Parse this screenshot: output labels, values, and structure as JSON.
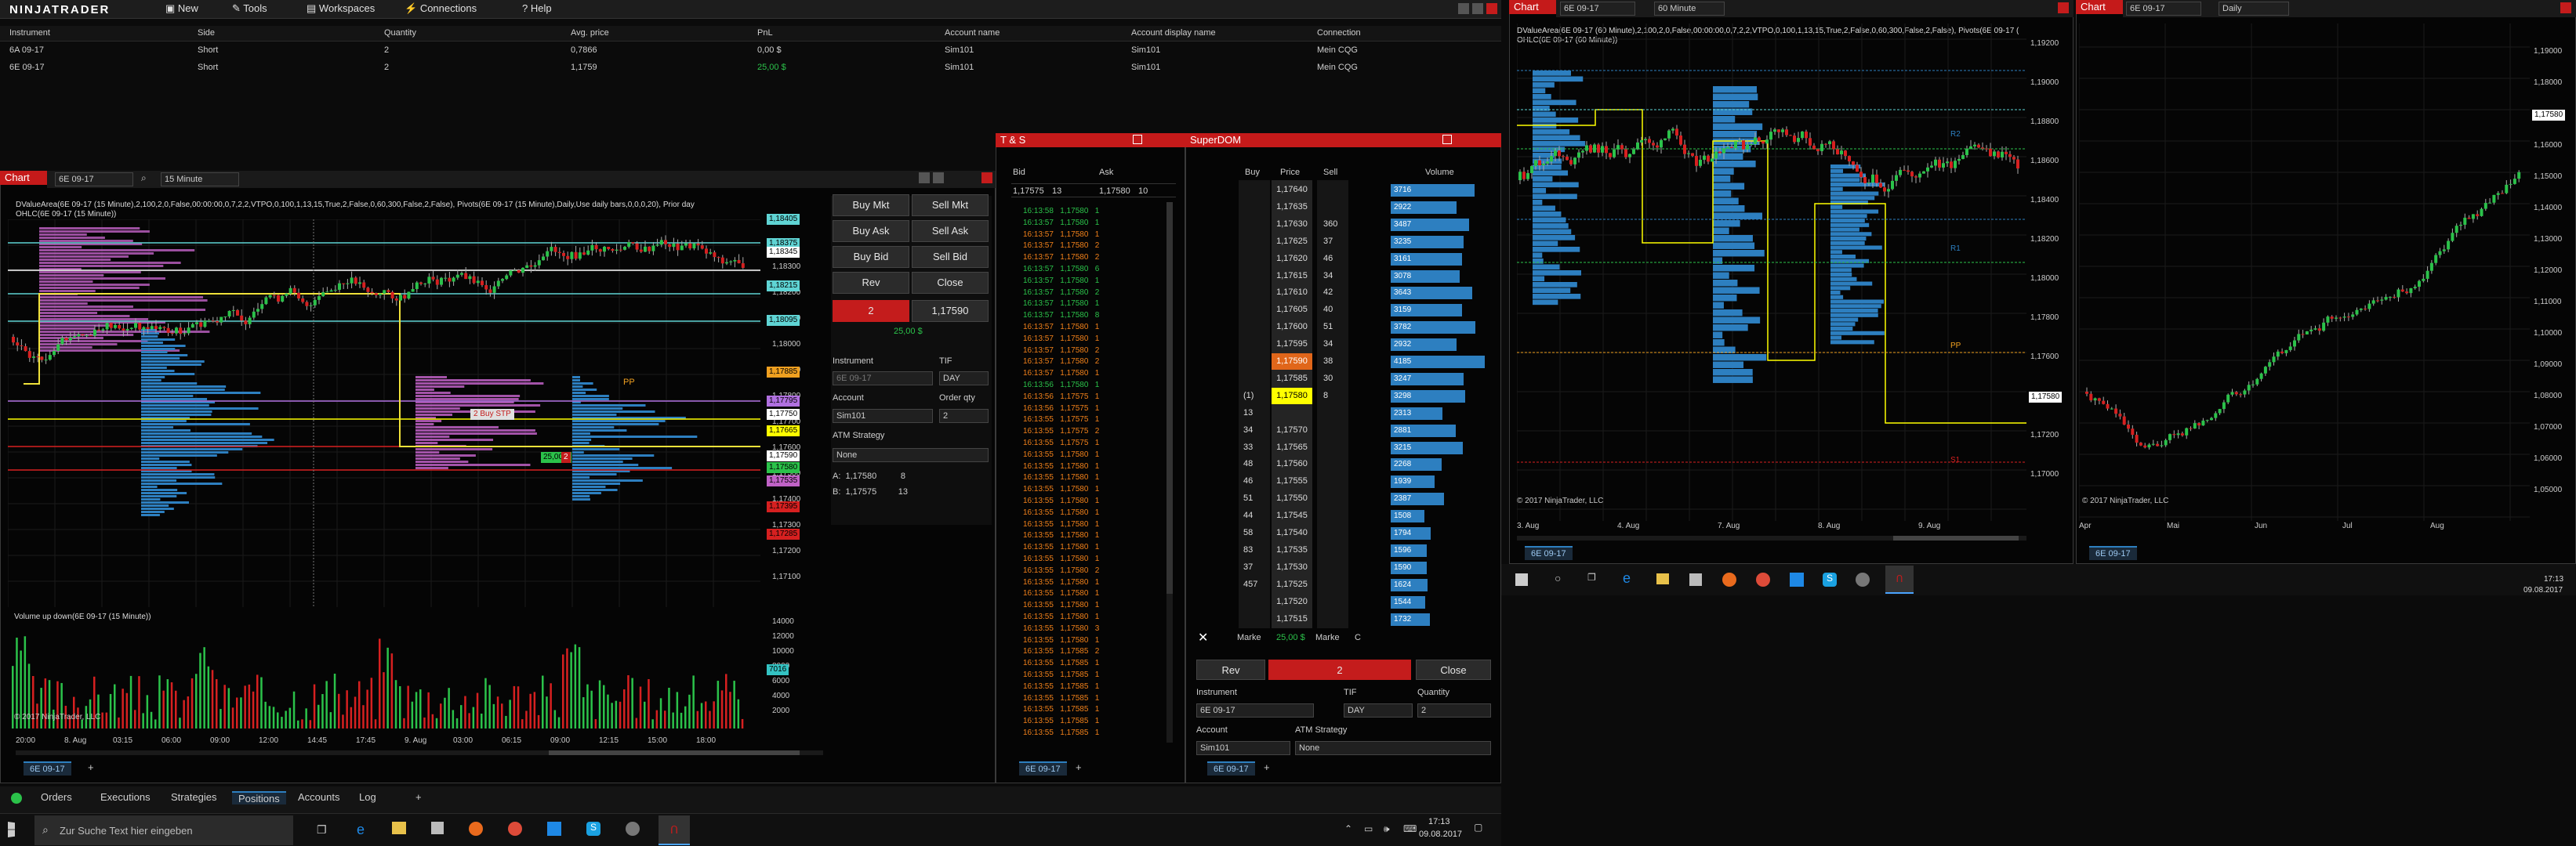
{
  "menubar": {
    "logo": "NINJATRADER",
    "items": [
      "New",
      "Tools",
      "Workspaces",
      "Connections",
      "Help"
    ]
  },
  "positions_grid": {
    "columns": [
      "Instrument",
      "Side",
      "Quantity",
      "Avg. price",
      "PnL",
      "Account name",
      "Account display name",
      "Connection"
    ],
    "rows": [
      [
        "6A 09-17",
        "Short",
        "2",
        "0,7866",
        "0,00 $",
        "Sim101",
        "Sim101",
        "Mein CQG"
      ],
      [
        "6E 09-17",
        "Short",
        "2",
        "1,1759",
        "25,00 $",
        "Sim101",
        "Sim101",
        "Mein CQG"
      ]
    ]
  },
  "chart1": {
    "title": "Chart",
    "instrument": "6E 09-17",
    "interval": "15 Minute",
    "indicator_line": "DValueArea(6E 09-17 (15 Minute),2,100,2,0,False,00:00:00,0,7,2,2,VTPO,0,100,1,13,15,True,2,False,0,60,300,False,2,False), Pivots(6E 09-17 (15 Minute),Daily,Use daily bars,0,0,0,20), Prior day",
    "ohlc_line": "OHLC(6E 09-17 (15 Minute))",
    "price_tags": [
      "1,18405",
      "1,18375",
      "1,18345",
      "1,18215",
      "1,18095",
      "1,17885",
      "1,17795",
      "1,17750",
      "1,17665",
      "1,17590",
      "1,17580",
      "1,17535",
      "1,17395",
      "1,17285"
    ],
    "axis_right": [
      "1,18300",
      "1,18200",
      "1,18100",
      "1,18000",
      "1,17900",
      "1,17800",
      "1,17700",
      "1,17600",
      "1,17500",
      "1,17400",
      "1,17300",
      "1,17200",
      "1,17100"
    ],
    "order_buy_stp": "2  Buy  STP",
    "order_tag": "25,00 $",
    "order_qty": "2",
    "pp_label": "PP",
    "volume_title": "Volume up down(6E 09-17 (15 Minute))",
    "volume_axis": [
      "14000",
      "12000",
      "10000",
      "8000",
      "6000",
      "4000",
      "2000"
    ],
    "volume_tag": "7016",
    "copyright": "© 2017 NinjaTrader, LLC",
    "time_axis": [
      "20:00",
      "8. Aug",
      "03:15",
      "06:00",
      "09:00",
      "12:00",
      "14:45",
      "17:45",
      "9. Aug",
      "03:00",
      "06:15",
      "09:00",
      "12:15",
      "15:00",
      "18:00"
    ],
    "tab": "6E 09-17"
  },
  "chart_trader": {
    "buttons": [
      "Buy Mkt",
      "Sell Mkt",
      "Buy Ask",
      "Sell Ask",
      "Buy Bid",
      "Sell Bid",
      "Rev",
      "Close"
    ],
    "position_qty": "2",
    "position_price": "1,17590",
    "position_pnl": "25,00 $",
    "instrument_label": "Instrument",
    "instrument_value": "6E 09-17",
    "tif_label": "TIF",
    "tif_value": "DAY",
    "account_label": "Account",
    "account_value": "Sim101",
    "qty_label": "Order qty",
    "qty_value": "2",
    "atm_label": "ATM Strategy",
    "atm_value": "None",
    "ask_line": "A:  1,17580          8",
    "bid_line": "B:  1,17575         13"
  },
  "ts": {
    "title": "T & S",
    "bid_label": "Bid",
    "ask_label": "Ask",
    "bid_price": "1,17575",
    "bid_size": "13",
    "ask_price": "1,17580",
    "ask_size": "10",
    "rows": [
      [
        "16:13:58",
        "1,17580",
        "1",
        "g"
      ],
      [
        "16:13:57",
        "1,17580",
        "1",
        "g"
      ],
      [
        "16:13:57",
        "1,17580",
        "1",
        "r"
      ],
      [
        "16:13:57",
        "1,17580",
        "2",
        "r"
      ],
      [
        "16:13:57",
        "1,17580",
        "2",
        "r"
      ],
      [
        "16:13:57",
        "1,17580",
        "6",
        "g"
      ],
      [
        "16:13:57",
        "1,17580",
        "1",
        "g"
      ],
      [
        "16:13:57",
        "1,17580",
        "2",
        "g"
      ],
      [
        "16:13:57",
        "1,17580",
        "1",
        "g"
      ],
      [
        "16:13:57",
        "1,17580",
        "8",
        "g"
      ],
      [
        "16:13:57",
        "1,17580",
        "1",
        "r"
      ],
      [
        "16:13:57",
        "1,17580",
        "1",
        "r"
      ],
      [
        "16:13:57",
        "1,17580",
        "2",
        "r"
      ],
      [
        "16:13:57",
        "1,17580",
        "2",
        "r"
      ],
      [
        "16:13:57",
        "1,17580",
        "1",
        "r"
      ],
      [
        "16:13:56",
        "1,17580",
        "1",
        "g"
      ],
      [
        "16:13:56",
        "1,17575",
        "1",
        "r"
      ],
      [
        "16:13:56",
        "1,17575",
        "1",
        "r"
      ],
      [
        "16:13:55",
        "1,17575",
        "1",
        "r"
      ],
      [
        "16:13:55",
        "1,17575",
        "2",
        "r"
      ],
      [
        "16:13:55",
        "1,17575",
        "1",
        "r"
      ],
      [
        "16:13:55",
        "1,17580",
        "1",
        "r"
      ],
      [
        "16:13:55",
        "1,17580",
        "1",
        "r"
      ],
      [
        "16:13:55",
        "1,17580",
        "1",
        "r"
      ],
      [
        "16:13:55",
        "1,17580",
        "1",
        "r"
      ],
      [
        "16:13:55",
        "1,17580",
        "1",
        "r"
      ],
      [
        "16:13:55",
        "1,17580",
        "1",
        "r"
      ],
      [
        "16:13:55",
        "1,17580",
        "1",
        "r"
      ],
      [
        "16:13:55",
        "1,17580",
        "1",
        "r"
      ],
      [
        "16:13:55",
        "1,17580",
        "1",
        "r"
      ],
      [
        "16:13:55",
        "1,17580",
        "1",
        "r"
      ],
      [
        "16:13:55",
        "1,17580",
        "2",
        "r"
      ],
      [
        "16:13:55",
        "1,17580",
        "1",
        "r"
      ],
      [
        "16:13:55",
        "1,17580",
        "1",
        "r"
      ],
      [
        "16:13:55",
        "1,17580",
        "1",
        "r"
      ],
      [
        "16:13:55",
        "1,17580",
        "1",
        "r"
      ],
      [
        "16:13:55",
        "1,17580",
        "3",
        "r"
      ],
      [
        "16:13:55",
        "1,17580",
        "1",
        "r"
      ],
      [
        "16:13:55",
        "1,17585",
        "2",
        "r"
      ],
      [
        "16:13:55",
        "1,17585",
        "1",
        "r"
      ],
      [
        "16:13:55",
        "1,17585",
        "1",
        "r"
      ],
      [
        "16:13:55",
        "1,17585",
        "1",
        "r"
      ],
      [
        "16:13:55",
        "1,17585",
        "1",
        "r"
      ],
      [
        "16:13:55",
        "1,17585",
        "1",
        "r"
      ],
      [
        "16:13:55",
        "1,17585",
        "1",
        "r"
      ],
      [
        "16:13:55",
        "1,17585",
        "1",
        "r"
      ]
    ],
    "tab": "6E 09-17"
  },
  "superdom": {
    "title": "SuperDOM",
    "buy_label": "Buy",
    "price_label": "Price",
    "sell_label": "Sell",
    "volume_label": "Volume",
    "rows": [
      {
        "buy": "",
        "price": "1,17640",
        "sell": "",
        "vol": "3716"
      },
      {
        "buy": "",
        "price": "1,17635",
        "sell": "",
        "vol": "2922"
      },
      {
        "buy": "",
        "price": "1,17630",
        "sell": "360",
        "vol": "3487"
      },
      {
        "buy": "",
        "price": "1,17625",
        "sell": "37",
        "vol": "3235"
      },
      {
        "buy": "",
        "price": "1,17620",
        "sell": "46",
        "vol": "3161"
      },
      {
        "buy": "",
        "price": "1,17615",
        "sell": "34",
        "vol": "3078"
      },
      {
        "buy": "",
        "price": "1,17610",
        "sell": "42",
        "vol": "3643"
      },
      {
        "buy": "",
        "price": "1,17605",
        "sell": "40",
        "vol": "3159"
      },
      {
        "buy": "",
        "price": "1,17600",
        "sell": "51",
        "vol": "3782"
      },
      {
        "buy": "",
        "price": "1,17595",
        "sell": "34",
        "vol": "2932"
      },
      {
        "buy": "",
        "price": "1,17590",
        "sell": "38",
        "vol": "4185"
      },
      {
        "buy": "",
        "price": "1,17585",
        "sell": "30",
        "vol": "3247"
      },
      {
        "buy": "(1)",
        "price": "1,17580",
        "sell": "8",
        "vol": "3298"
      },
      {
        "buy": "13",
        "price": "",
        "sell": "",
        "vol": "2313"
      },
      {
        "buy": "34",
        "price": "1,17570",
        "sell": "",
        "vol": "2881"
      },
      {
        "buy": "33",
        "price": "1,17565",
        "sell": "",
        "vol": "3215"
      },
      {
        "buy": "48",
        "price": "1,17560",
        "sell": "",
        "vol": "2268"
      },
      {
        "buy": "46",
        "price": "1,17555",
        "sell": "",
        "vol": "1939"
      },
      {
        "buy": "51",
        "price": "1,17550",
        "sell": "",
        "vol": "2387"
      },
      {
        "buy": "44",
        "price": "1,17545",
        "sell": "",
        "vol": "1508"
      },
      {
        "buy": "58",
        "price": "1,17540",
        "sell": "",
        "vol": "1794"
      },
      {
        "buy": "83",
        "price": "1,17535",
        "sell": "",
        "vol": "1596"
      },
      {
        "buy": "37",
        "price": "1,17530",
        "sell": "",
        "vol": "1590"
      },
      {
        "buy": "457",
        "price": "1,17525",
        "sell": "",
        "vol": "1624"
      },
      {
        "buy": "",
        "price": "1,17520",
        "sell": "",
        "vol": "1544"
      },
      {
        "buy": "",
        "price": "1,17515",
        "sell": "",
        "vol": "1732"
      }
    ],
    "market_left": "Marke",
    "market_pnl": "25,00 $",
    "market_right": "Marke",
    "c": "C",
    "rev": "Rev",
    "qty": "2",
    "close": "Close",
    "instrument_label": "Instrument",
    "instrument_value": "6E 09-17",
    "tif_label": "TIF",
    "tif_value": "DAY",
    "quantity_label": "Quantity",
    "quantity_value": "2",
    "account_label": "Account",
    "account_value": "Sim101",
    "atm_label": "ATM Strategy",
    "atm_value": "None",
    "tab": "6E 09-17"
  },
  "bottom_tabs": [
    "Orders",
    "Executions",
    "Strategies",
    "Positions",
    "Accounts",
    "Log"
  ],
  "chart2": {
    "title": "Chart",
    "instrument": "6E 09-17",
    "interval": "60 Minute",
    "indicator_line": "DValueArea(6E 09-17 (60 Minute),2,100,2,0,False,00:00:00,0,7,2,2,VTPO,0,100,1,13,15,True,2,False,0,60,300,False,2,False), Pivots(6E 09-17 (60 Minute),Daily,Use daily bars,0,0,0,20), Prior day",
    "ohlc_line": "OHLC(6E 09-17 (60 Minute))",
    "axis_right": [
      "1,19200",
      "1,19000",
      "1,18800",
      "1,18600",
      "1,18400",
      "1,18200",
      "1,18000",
      "1,17800",
      "1,17600",
      "1,17400",
      "1,17200",
      "1,17000"
    ],
    "price_tag": "1,17580",
    "labels": [
      "R2",
      "R1",
      "PP",
      "S1"
    ],
    "copyright": "© 2017 NinjaTrader, LLC",
    "time_axis": [
      "3. Aug",
      "4. Aug",
      "7. Aug",
      "8. Aug",
      "9. Aug"
    ],
    "tab": "6E 09-17"
  },
  "chart3": {
    "title": "Chart",
    "instrument": "6E 09-17",
    "interval": "Daily",
    "axis_right": [
      "1,19000",
      "1,18000",
      "1,17000",
      "1,16000",
      "1,15000",
      "1,14000",
      "1,13000",
      "1,12000",
      "1,11000",
      "1,10000",
      "1,09000",
      "1,08000",
      "1,07000",
      "1,06000",
      "1,05000"
    ],
    "price_tag": "1,17580",
    "copyright": "© 2017 NinjaTrader, LLC",
    "time_axis": [
      "Apr",
      "Mai",
      "Jun",
      "Jul",
      "Aug"
    ],
    "tab": "6E 09-17"
  },
  "taskbar": {
    "search_placeholder": "Zur Suche Text hier eingeben",
    "time": "17:13",
    "date": "09.08.2017"
  },
  "taskbar2": {
    "time": "17:13",
    "date": "09.08.2017"
  },
  "colors": {
    "accent_red": "#c41c1c",
    "buy_green": "#2bc24a",
    "ask_yellow": "#ffff00",
    "profile_blue": "#2d7fc0",
    "profile_pink": "#c062c6",
    "volume_red": "#d62020",
    "value_area_yellow": "#f0e23a"
  }
}
